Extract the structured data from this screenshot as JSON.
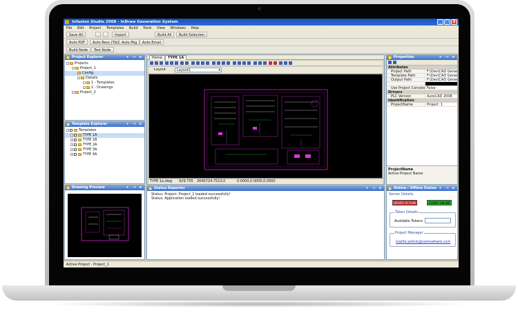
{
  "window": {
    "title": "Infusion Studio 2008 - InDraw Generation System",
    "min": "_",
    "max": "□",
    "close": "X"
  },
  "menu": [
    "File",
    "Edit",
    "Project",
    "Templates",
    "Build",
    "Tools",
    "View",
    "Windows",
    "Help"
  ],
  "toolbar1": {
    "save_all": "Save All",
    "import": "Import",
    "build_all": "Build All",
    "build_selection": "Build Selection"
  },
  "toolbar2": {
    "auto_pdf": "Auto PDF",
    "auto_revs": "Auto Revs (Tbl)",
    "auto_pkg": "Auto Pkg",
    "auto_email": "Auto Email"
  },
  "toolbar3": {
    "build_node": "Build Node",
    "test_node": "Test Node"
  },
  "project_explorer": {
    "title": "Project Explorer",
    "items": [
      "Projects",
      "Project_1",
      "Config",
      "Details",
      "1 - Templates",
      "2 - Drawings",
      "Project_2"
    ]
  },
  "template_explorer": {
    "title": "Template Explorer",
    "root": "Templates",
    "items": [
      "TYPE 1A",
      "TYPE 1B",
      "TYPE 2A",
      "TYPE 3A",
      "TYPE 4A"
    ]
  },
  "document": {
    "tabs": [
      "Home",
      "TYPE 1A"
    ],
    "layout_label": "Layout",
    "layout_value": "Layout1",
    "status": [
      "TYPE 1a.dwg",
      "929.755",
      "2640724.7513,0",
      "0.0000,0.0000,0.0000"
    ]
  },
  "properties": {
    "title": "Properties",
    "categories": [
      {
        "name": "Attributes",
        "rows": [
          [
            "Project Path",
            "F:\\Dev\\CAD Generation\\Data"
          ],
          [
            "Template Path",
            "F:\\Dev\\CAD Generation\\Data"
          ],
          [
            "Output Path",
            "F:\\Dev\\CAD Generation\\Data"
          ],
          [
            "",
            ""
          ],
          [
            "Use Project Console",
            "False"
          ]
        ]
      },
      {
        "name": "Drivers",
        "rows": [
          [
            "PLC Version",
            "AutoCAD 2008"
          ]
        ]
      },
      {
        "name": "Identification",
        "rows": [
          [
            "ProjectName",
            "Project_1"
          ]
        ]
      }
    ],
    "help_title": "ProjectName",
    "help_text": "Active Project Name"
  },
  "drawing_preview": {
    "title": "Drawing Preview"
  },
  "status_reporter": {
    "title": "Status Reporter",
    "lines": [
      "Status: Project: Project_1 loaded successfully!",
      "Status: Application loaded successfully!"
    ]
  },
  "online_status": {
    "title": "Online / Offline Status",
    "server_details": "Server Details",
    "offline_label": "SERVER OFFLINE",
    "online_label": "CLIENT ONLINE",
    "token_details": "Token Details",
    "available_tokens": "Available Tokens",
    "project_manager": "Project Manager",
    "email": "mailto:admin@somewhere.com"
  },
  "statusbar": {
    "text": "Active Project : Project_1"
  },
  "colors": {
    "accent": "#2a6de0",
    "drawing_bg": "#000000",
    "drawing_line": "#cc22cc",
    "offline": "#cc2222",
    "online": "#22aa22"
  }
}
